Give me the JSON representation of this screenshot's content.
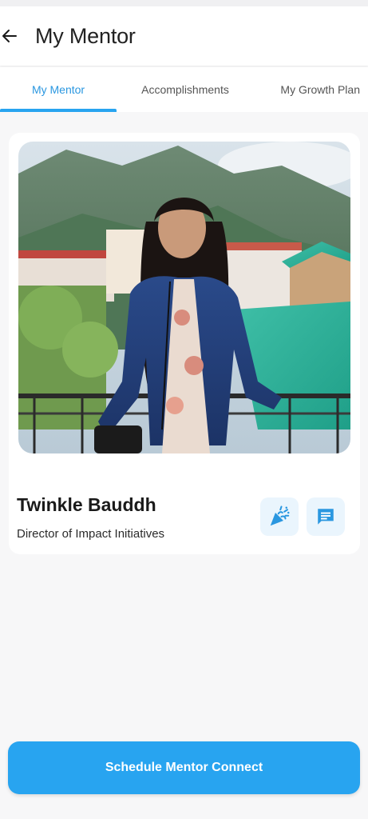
{
  "app_bar": {
    "title": "My Mentor",
    "back_icon": "arrow-left-icon"
  },
  "tabs": [
    {
      "label": "My Mentor",
      "active": true
    },
    {
      "label": "Accomplishments",
      "active": false
    },
    {
      "label": "My Growth Plan",
      "active": false
    }
  ],
  "mentor": {
    "name": "Twinkle Bauddh",
    "role": "Director of Impact Initiatives",
    "celebrate_icon": "party-popper-icon",
    "chat_icon": "chat-message-icon"
  },
  "cta": {
    "label": "Schedule Mentor Connect"
  },
  "colors": {
    "accent": "#28a4f0",
    "icon_bg": "#eaf5fd",
    "background": "#f7f7f8"
  }
}
